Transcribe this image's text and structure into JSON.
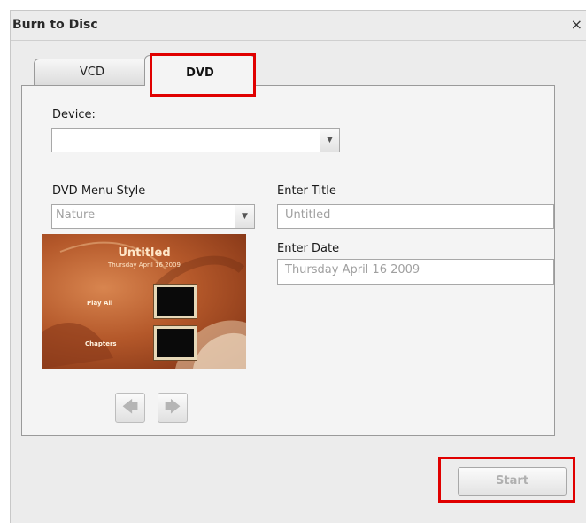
{
  "window": {
    "title": "Burn to Disc",
    "close_glyph": "×"
  },
  "tabs": [
    {
      "label": "VCD",
      "active": false
    },
    {
      "label": "DVD",
      "active": true
    }
  ],
  "device": {
    "label": "Device:",
    "value": ""
  },
  "menu_style": {
    "label": "DVD Menu Style",
    "value": "Nature"
  },
  "title_field": {
    "label": "Enter Title",
    "placeholder": "Untitled"
  },
  "date_field": {
    "label": "Enter Date",
    "placeholder": "Thursday  April 16  2009"
  },
  "preview": {
    "title": "Untitled",
    "date": "Thursday  April 16  2009",
    "play_all": "Play All",
    "chapters": "Chapters"
  },
  "nav": {
    "prev_glyph": "🡄",
    "next_glyph": "🡆"
  },
  "actions": {
    "start_label": "Start"
  },
  "colors": {
    "highlight": "#e00000"
  }
}
